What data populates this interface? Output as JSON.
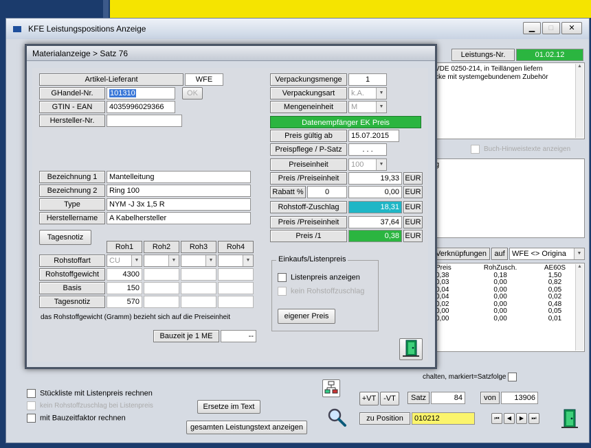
{
  "main_window": {
    "title": "KFE Leistungspositions Anzeige",
    "leistungs_nr_label": "Leistungs-Nr.",
    "leistungs_nr_value": "01.02.12",
    "desc_line1": "VDE 0250-214, in Teillängen liefern",
    "desc_line2": "cke mit systemgebundenem Zubehör",
    "buch_hinweis": "Buch-Hinweistexte anzeigen",
    "right_text": "g",
    "verknuepfungen": "Verknüpfungen",
    "auf": "auf",
    "combo_value": "WFE <> Origina",
    "table_headers": [
      "Preis",
      "RohZusch.",
      "AE60S"
    ],
    "table_rows": [
      [
        "0,38",
        "0,18",
        "1,50"
      ],
      [
        "0,03",
        "0,00",
        "0,82"
      ],
      [
        "0,04",
        "0,00",
        "0,05"
      ],
      [
        "0,04",
        "0,00",
        "0,02"
      ],
      [
        "0,02",
        "0,00",
        "0,48"
      ],
      [
        "0,00",
        "0,00",
        "0,05"
      ],
      [
        "0,00",
        "0,00",
        "0,01"
      ]
    ],
    "schalten_text": "chalten, markiert=Satzfolge",
    "btn_plus_vt": "+VT",
    "btn_minus_vt": "-VT",
    "satz_label": "Satz",
    "satz_value": "84",
    "von_label": "von",
    "von_value": "13906",
    "zu_position_label": "zu Position",
    "zu_position_value": "010212",
    "nav_buttons": [
      "⏮",
      "◀",
      "▶",
      "⏭"
    ],
    "chk_stueckliste": "Stückliste mit Listenpreis rechnen",
    "chk_kein_rohstoff": "kein Rohstoffzuschlag bei Listenpreis",
    "chk_bauzeitfaktor": "mit Bauzeitfaktor rechnen",
    "btn_ersetze": "Ersetze im Text",
    "btn_gesamten": "gesamten Leistungstext anzeigen"
  },
  "dialog": {
    "title": "Materialanzeige > Satz 76",
    "artikel_lieferant_label": "Artikel-Lieferant",
    "artikel_lieferant_value": "WFE",
    "ghandel_label": "GHandel-Nr.",
    "ghandel_value": "101310",
    "ok_label": "OK",
    "gtin_label": "GTIN - EAN",
    "gtin_value": "4035996029366",
    "hersteller_nr_label": "Hersteller-Nr.",
    "hersteller_nr_value": "",
    "bez1_label": "Bezeichnung 1",
    "bez1_value": "Mantelleitung",
    "bez2_label": "Bezeichnung 2",
    "bez2_value": "Ring 100",
    "type_label": "Type",
    "type_value": "NYM -J  3x 1,5 R",
    "herstellername_label": "Herstellername",
    "herstellername_value": "A Kabelhersteller",
    "tagesnotiz_btn": "Tagesnotiz",
    "roh_headers": [
      "Roh1",
      "Roh2",
      "Roh3",
      "Roh4"
    ],
    "rohstoffart_label": "Rohstoffart",
    "rohstoffart_values": [
      "CU",
      "",
      "",
      ""
    ],
    "rohstoffgewicht_label": "Rohstoffgewicht",
    "rohstoffgewicht_value": "4300",
    "basis_label": "Basis",
    "basis_value": "150",
    "tagesnotiz_label": "Tagesnotiz",
    "tagesnotiz_value": "570",
    "hint": "das Rohstoffgewicht (Gramm) bezieht sich auf die Preiseinheit",
    "bauzeit_label": "Bauzeit je 1 ME",
    "bauzeit_value": "--",
    "verpackungsmenge_label": "Verpackungsmenge",
    "verpackungsmenge_value": "1",
    "verpackungsart_label": "Verpackungsart",
    "verpackungsart_value": "k.A.",
    "mengeneinheit_label": "Mengeneinheit",
    "mengeneinheit_value": "M",
    "datenempfaenger": "Datenempfänger EK Preis",
    "preis_gueltig_label": "Preis gültig ab",
    "preis_gueltig_value": "15.07.2015",
    "preispflege_label": "Preispflege / P-Satz",
    "preispflege_value": ". . .",
    "preiseinheit_label": "Preiseinheit",
    "preiseinheit_value": "100",
    "preis_pe1_label": "Preis /Preiseinheit",
    "preis_pe1_value": "19,33",
    "eur": "EUR",
    "rabatt_label": "Rabatt %",
    "rabatt_value": "0",
    "rabatt_amount": "0,00",
    "rohstoff_zuschlag_label": "Rohstoff-Zuschlag",
    "rohstoff_zuschlag_value": "18,31",
    "preis_pe2_label": "Preis /Preiseinheit",
    "preis_pe2_value": "37,64",
    "preis1_label": "Preis /1",
    "preis1_value": "0,38",
    "einkauf_group": "Einkaufs/Listenpreis",
    "listenpreis_chk": "Listenpreis anzeigen",
    "kein_rohstoff_chk": "kein Rohstoffzuschlag",
    "eigener_preis_btn": "eigener Preis"
  },
  "colors": {
    "green": "#2bb540",
    "teal": "#1fb6c6",
    "yellow": "#fbf46c",
    "title_yellow": "#f5e400"
  }
}
